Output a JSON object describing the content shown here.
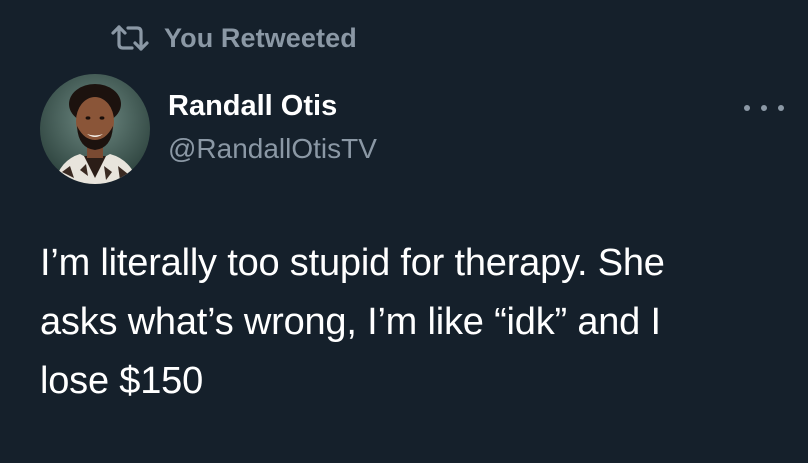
{
  "retweet_banner": {
    "icon": "retweet-icon",
    "label": "You Retweeted"
  },
  "tweet": {
    "author": {
      "display_name": "Randall Otis",
      "handle": "@RandallOtisTV",
      "avatar": "avatar-photo"
    },
    "more_icon": "more-horizontal-icon",
    "text": "I’m literally too stupid for therapy. She\nasks what’s wrong, I’m like “idk” and I\nlose $150"
  },
  "colors": {
    "background": "#15202b",
    "primary_text": "#ffffff",
    "secondary_text": "#8b98a5"
  }
}
